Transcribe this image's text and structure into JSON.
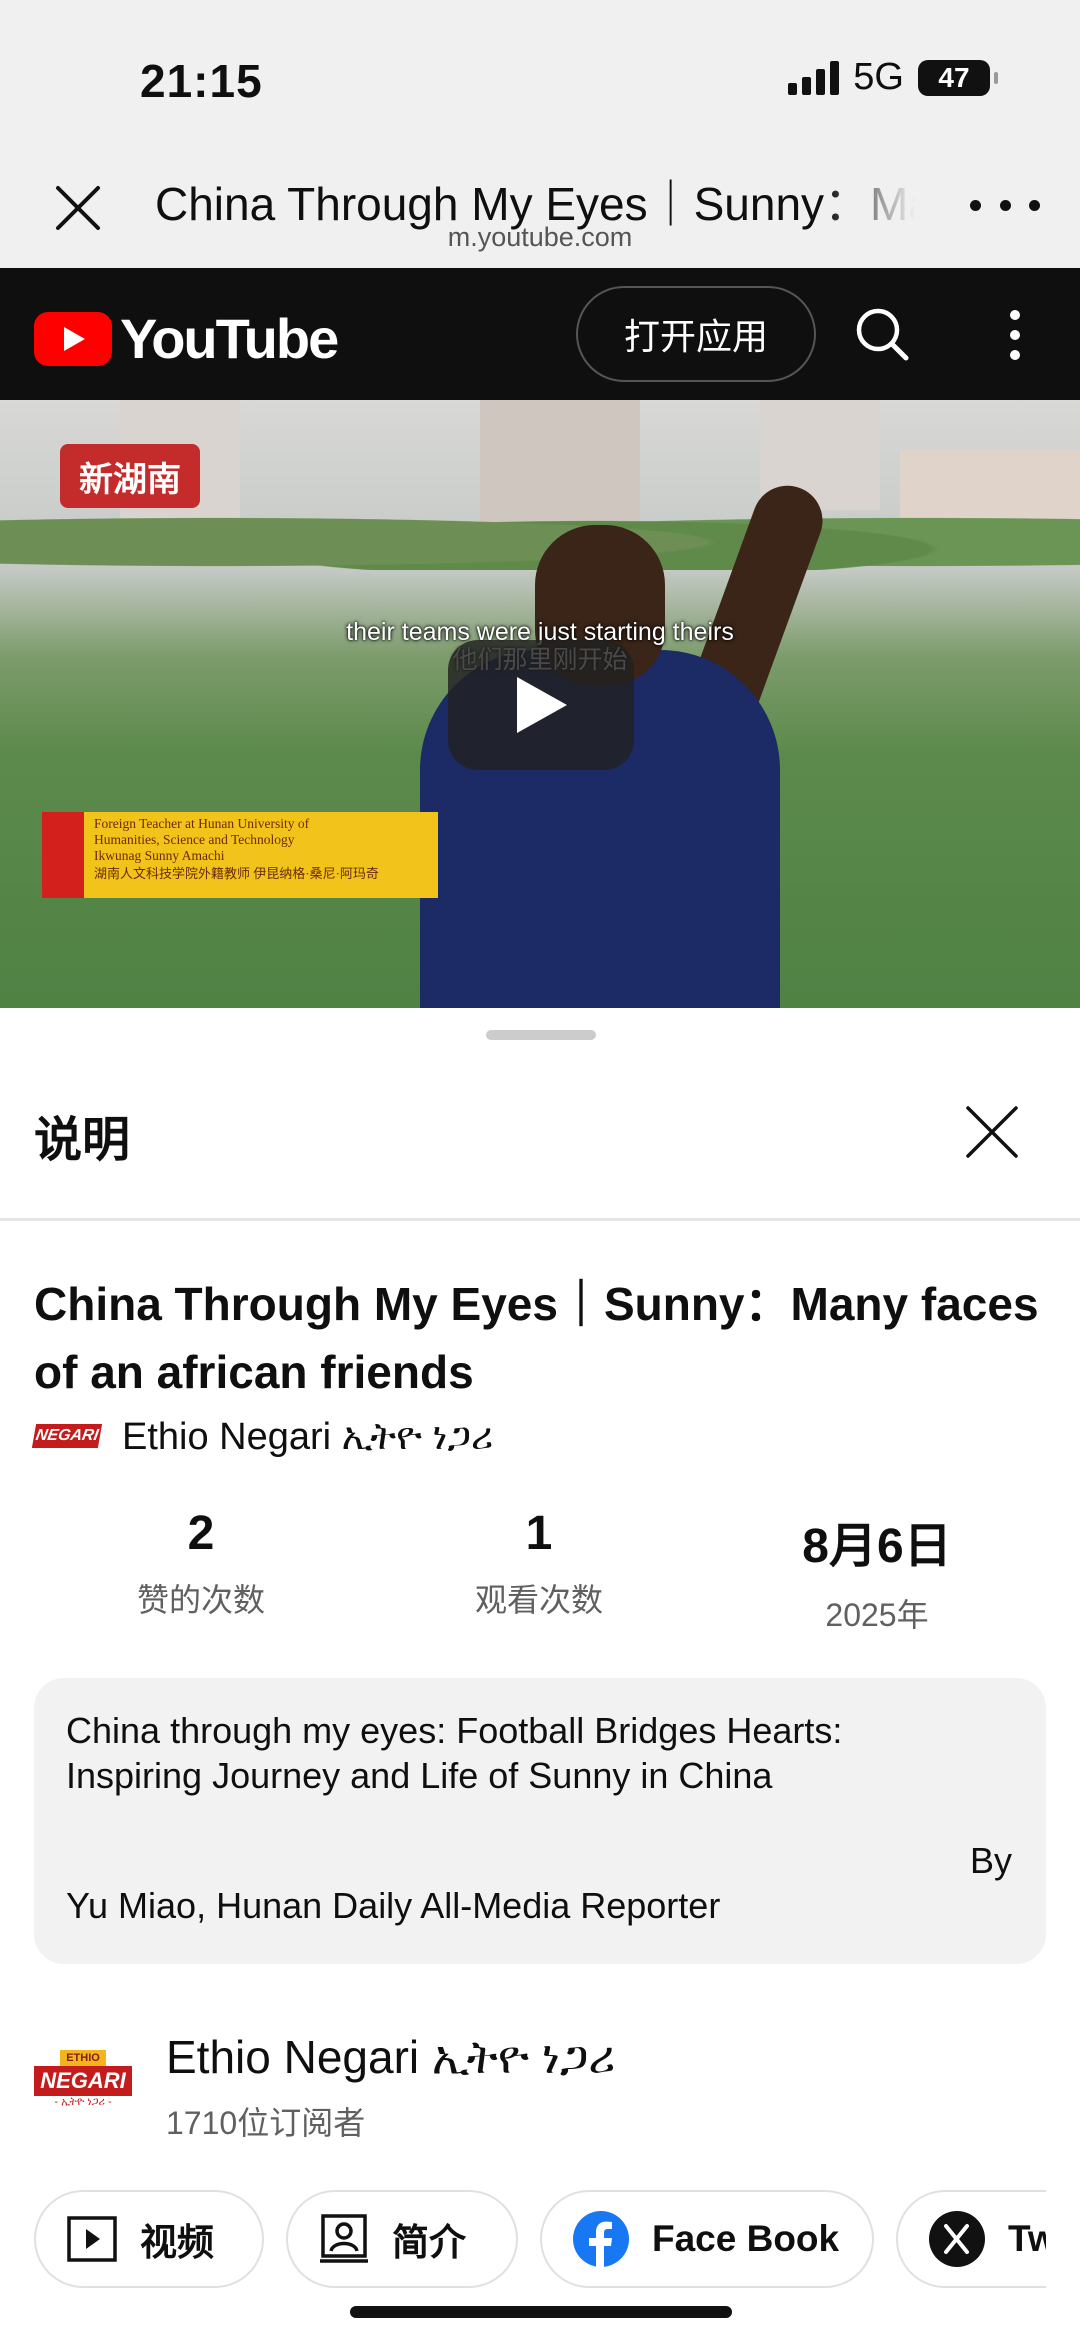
{
  "status": {
    "time": "21:15",
    "network": "5G",
    "battery": "47"
  },
  "browser": {
    "title": "China Through My Eyes｜Sunny：Many faces of an african friends",
    "url": "m.youtube.com"
  },
  "youtube": {
    "logo_text": "YouTube",
    "open_app": "打开应用"
  },
  "video": {
    "badge": "新湖南",
    "lower_third": [
      "Foreign Teacher at Hunan University of",
      "Humanities, Science and Technology",
      "Ikwunag Sunny Amachi",
      "湖南人文科技学院外籍教师 伊昆纳格·桑尼·阿玛奇"
    ],
    "subtitle_en": "their teams were just starting theirs",
    "subtitle_cn": "他们那里刚开始"
  },
  "sheet": {
    "title": "说明",
    "video_title": "China Through My Eyes｜Sunny：Many faces of an african friends",
    "channel": "Ethio Negari ኢትዮ ነጋሪ",
    "logo_word": "NEGARI",
    "logo_tag": "ETHIO",
    "logo_eth": "- ኢትዮ ነጋሪ -",
    "stats": [
      {
        "value": "2",
        "label": "赞的次数"
      },
      {
        "value": "1",
        "label": "观看次数"
      },
      {
        "value": "8月6日",
        "label": "2025年"
      }
    ],
    "description": {
      "line1": "China through my eyes: Football Bridges Hearts:",
      "line2": "Inspiring Journey and Life of Sunny in China",
      "by": "By",
      "reporter": "Yu Miao, Hunan Daily All-Media Reporter"
    },
    "channel_block": {
      "name": "Ethio Negari ኢትዮ ነጋሪ",
      "subscribers": "1710位订阅者"
    },
    "chips": [
      {
        "label": "视频",
        "icon": "video-icon"
      },
      {
        "label": "简介",
        "icon": "profile-icon"
      },
      {
        "label": "Face Book",
        "icon": "facebook-icon"
      },
      {
        "label": "Tw",
        "icon": "x-twitter-icon"
      }
    ]
  },
  "colors": {
    "yt_red": "#ff0000",
    "yt_header": "#0f0f0f",
    "facebook_blue": "#1877f2"
  }
}
